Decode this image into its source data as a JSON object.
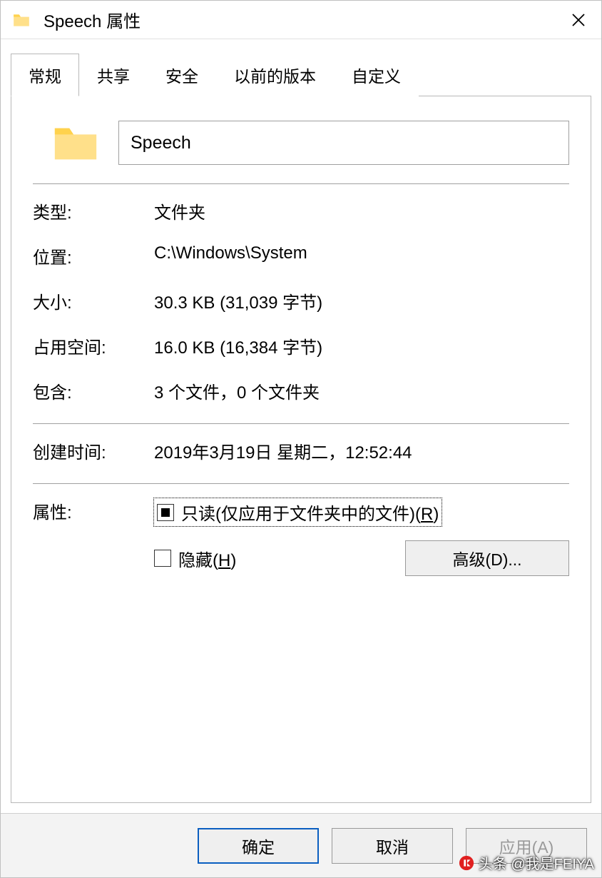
{
  "titlebar": {
    "title": "Speech 属性"
  },
  "tabs": [
    "常规",
    "共享",
    "安全",
    "以前的版本",
    "自定义"
  ],
  "general": {
    "name_value": "Speech",
    "type_label": "类型:",
    "type_value": "文件夹",
    "location_label": "位置:",
    "location_value": "C:\\Windows\\System",
    "size_label": "大小:",
    "size_value": "30.3 KB (31,039 字节)",
    "size_on_disk_label": "占用空间:",
    "size_on_disk_value": "16.0 KB (16,384 字节)",
    "contains_label": "包含:",
    "contains_value": "3 个文件，0 个文件夹",
    "created_label": "创建时间:",
    "created_value": "2019年3月19日 星期二，12:52:44",
    "attributes_label": "属性:",
    "readonly_prefix": "只读(仅应用于文件夹中的文件)(",
    "readonly_accel": "R",
    "readonly_suffix": ")",
    "hidden_prefix": "隐藏(",
    "hidden_accel": "H",
    "hidden_suffix": ")",
    "advanced_label": "高级(D)..."
  },
  "buttons": {
    "ok": "确定",
    "cancel": "取消",
    "apply": "应用(A)"
  },
  "watermark": "头条 @我是FEIYA"
}
